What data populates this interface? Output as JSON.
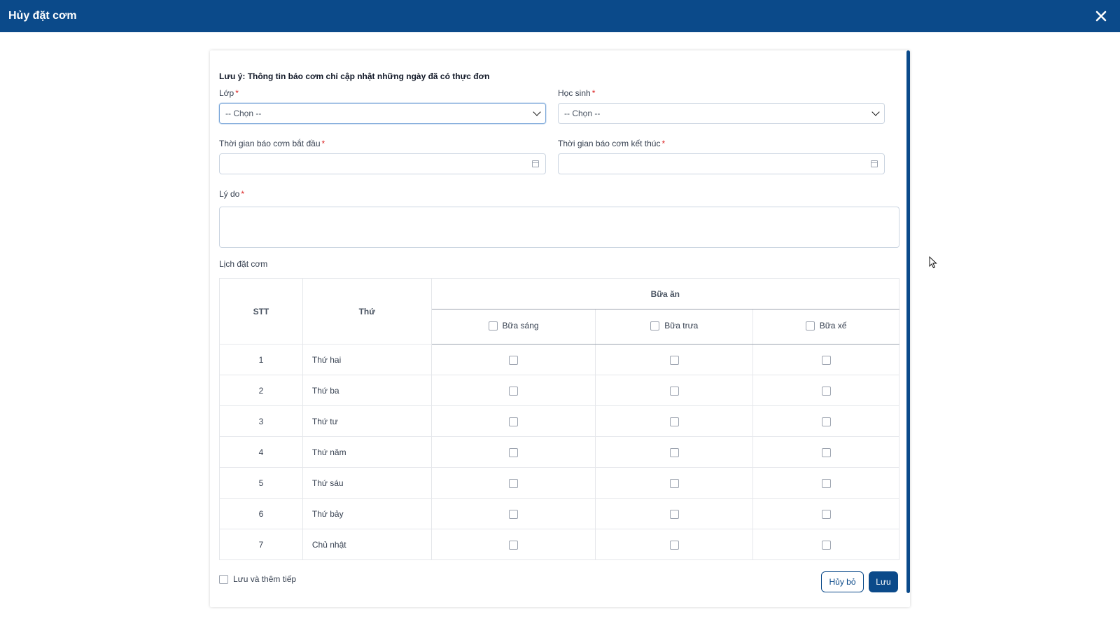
{
  "header": {
    "title": "Hủy đặt cơm"
  },
  "form": {
    "note": "Lưu ý: Thông tin báo cơm chỉ cập nhật những ngày đã có thực đơn",
    "class_label": "Lớp",
    "class_value": "-- Chọn --",
    "student_label": "Học sinh",
    "student_value": "-- Chọn --",
    "start_label": "Thời gian báo cơm bắt đầu",
    "end_label": "Thời gian báo cơm kết thúc",
    "reason_label": "Lý do",
    "required_mark": "*"
  },
  "schedule": {
    "title": "Lịch đặt cơm",
    "col_stt": "STT",
    "col_day": "Thứ",
    "col_meals": "Bữa ăn",
    "meals": [
      "Bữa sáng",
      "Bữa trưa",
      "Bữa xế"
    ],
    "rows": [
      {
        "stt": "1",
        "day": "Thứ hai"
      },
      {
        "stt": "2",
        "day": "Thứ ba"
      },
      {
        "stt": "3",
        "day": "Thứ tư"
      },
      {
        "stt": "4",
        "day": "Thứ năm"
      },
      {
        "stt": "5",
        "day": "Thứ sáu"
      },
      {
        "stt": "6",
        "day": "Thứ bảy"
      },
      {
        "stt": "7",
        "day": "Chủ nhật"
      }
    ]
  },
  "footer": {
    "save_and_add_label": "Lưu và thêm tiếp",
    "cancel_label": "Hủy bỏ",
    "save_label": "Lưu"
  },
  "colors": {
    "primary": "#0b4a8a",
    "required": "#dc2626"
  },
  "icons": {
    "close": "close-icon",
    "dropdown": "chevron-down-icon",
    "date": "calendar-icon"
  }
}
